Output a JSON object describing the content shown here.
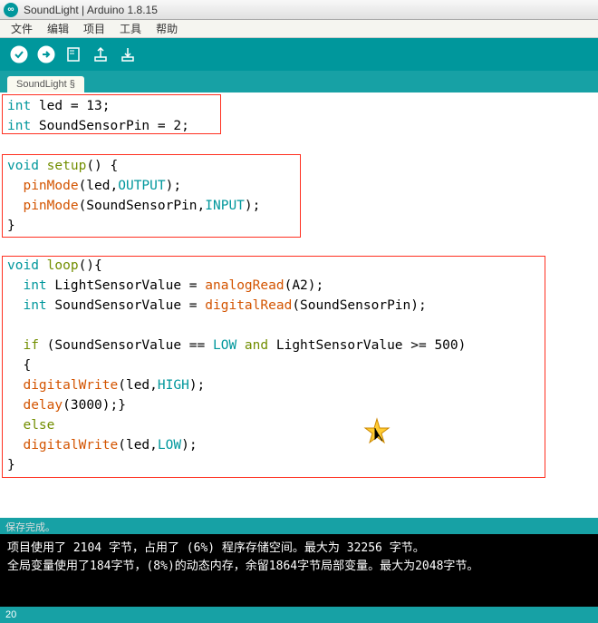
{
  "window": {
    "title": "SoundLight | Arduino 1.8.15",
    "appIconLetter": "∞"
  },
  "menu": {
    "file": "文件",
    "edit": "编辑",
    "sketch": "项目",
    "tools": "工具",
    "help": "帮助"
  },
  "tabs": {
    "main": "SoundLight §"
  },
  "code": {
    "l1_kw": "int",
    "l1_rest": " led = 13;",
    "l2_kw": "int",
    "l2_rest": " SoundSensorPin = 2;",
    "l4_kw": "void",
    "l4_fn": " setup",
    "l4_rest": "() {",
    "l5_pad": "  ",
    "l5_fn": "pinMode",
    "l5_a": "(led,",
    "l5_c": "OUTPUT",
    "l5_b": ");",
    "l6_pad": "  ",
    "l6_fn": "pinMode",
    "l6_a": "(SoundSensorPin,",
    "l6_c": "INPUT",
    "l6_b": ");",
    "l7": "}",
    "l9_kw": "void",
    "l9_fn": " loop",
    "l9_rest": "(){",
    "l10_pad": "  ",
    "l10_kw": "int",
    "l10_mid": " LightSensorValue = ",
    "l10_fn": "analogRead",
    "l10_rest": "(A2);",
    "l11_pad": "  ",
    "l11_kw": "int",
    "l11_mid": " SoundSensorValue = ",
    "l11_fn": "digitalRead",
    "l11_rest": "(SoundSensorPin);",
    "l13_pad": "  ",
    "l13_kw": "if",
    "l13_a": " (SoundSensorValue == ",
    "l13_low": "LOW",
    "l13_and": " and ",
    "l13_b": "LightSensorValue >= 500)",
    "l14": "  {",
    "l15_pad": "  ",
    "l15_fn": "digitalWrite",
    "l15_a": "(led,",
    "l15_c": "HIGH",
    "l15_b": ");",
    "l16_pad": "  ",
    "l16_fn": "delay",
    "l16_rest": "(3000);}",
    "l17_pad": "  ",
    "l17_kw": "else",
    "l18_pad": "  ",
    "l18_fn": "digitalWrite",
    "l18_a": "(led,",
    "l18_c": "LOW",
    "l18_b": ");",
    "l19": "}"
  },
  "status": {
    "label": "保存完成。"
  },
  "console": {
    "line1": "项目使用了 2104 字节，占用了 (6%) 程序存储空间。最大为 32256 字节。",
    "line2": "全局变量使用了184字节，(8%)的动态内存，余留1864字节局部变量。最大为2048字节。"
  },
  "footer": {
    "line": "20"
  }
}
